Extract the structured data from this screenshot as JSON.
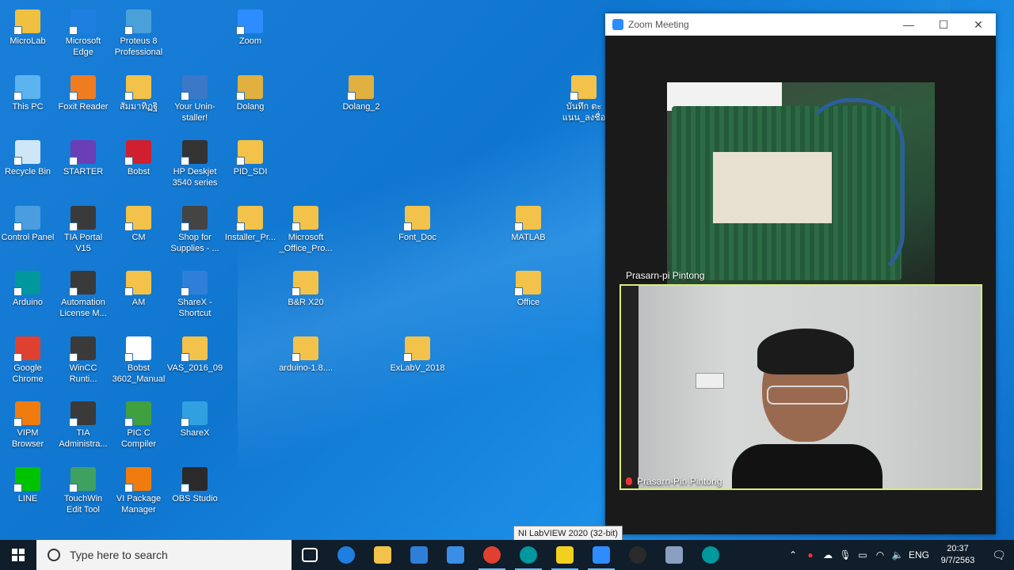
{
  "desktop_icons": [
    {
      "label": "MicroLab",
      "color": "#f0c040"
    },
    {
      "label": "Microsoft Edge",
      "color": "#1f7fe0"
    },
    {
      "label": "Proteus 8 Professional",
      "color": "#4aa0d8"
    },
    {
      "label": "Zoom",
      "color": "#2d8cff"
    },
    {
      "label": "This PC",
      "color": "#5bb4f0"
    },
    {
      "label": "Foxit Reader",
      "color": "#f07c20"
    },
    {
      "label": "สัมมาทิฏฐิ",
      "color": "#f2c24a"
    },
    {
      "label": "Your Unin-staller!",
      "color": "#3a78c8"
    },
    {
      "label": "Dolang",
      "color": "#e0b040"
    },
    {
      "label": "Dolang_2",
      "color": "#e0b040"
    },
    {
      "label": "บันทึก ตะแนน_ลงชื่อ",
      "color": "#f2c24a"
    },
    {
      "label": "Recycle Bin",
      "color": "#cfe6f7"
    },
    {
      "label": "STARTER",
      "color": "#6a3fb5"
    },
    {
      "label": "Bobst",
      "color": "#d02030"
    },
    {
      "label": "HP Deskjet 3540 series",
      "color": "#333333"
    },
    {
      "label": "PID_SDI",
      "color": "#f2c24a"
    },
    {
      "label": "Control Panel",
      "color": "#4a9ee0"
    },
    {
      "label": "TIA Portal V15",
      "color": "#3a3a3a"
    },
    {
      "label": "CM",
      "color": "#f2c24a"
    },
    {
      "label": "Shop for Supplies - ...",
      "color": "#444444"
    },
    {
      "label": "Installer_Pr...",
      "color": "#f2c24a"
    },
    {
      "label": "Microsoft _Office_Pro...",
      "color": "#f2c24a"
    },
    {
      "label": "Font_Doc",
      "color": "#f2c24a"
    },
    {
      "label": "MATLAB",
      "color": "#f2c24a"
    },
    {
      "label": "Arduino",
      "color": "#00979d"
    },
    {
      "label": "Automation License M...",
      "color": "#3a3a3a"
    },
    {
      "label": "AM",
      "color": "#f2c24a"
    },
    {
      "label": "ShareX - Shortcut",
      "color": "#2f7fd8"
    },
    {
      "label": "B&R X20",
      "color": "#f2c24a"
    },
    {
      "label": "Office",
      "color": "#f2c24a"
    },
    {
      "label": "Google Chrome",
      "color": "#e04030"
    },
    {
      "label": "WinCC Runti...",
      "color": "#3a3a3a"
    },
    {
      "label": "Bobst 3602_Manual",
      "color": "#ffffff"
    },
    {
      "label": "VAS_2016_09",
      "color": "#f2c24a"
    },
    {
      "label": "arduino-1.8....",
      "color": "#f2c24a"
    },
    {
      "label": "ExLabV_2018",
      "color": "#f2c24a"
    },
    {
      "label": "VIPM Browser",
      "color": "#f07c10"
    },
    {
      "label": "TIA Administra...",
      "color": "#3a3a3a"
    },
    {
      "label": "PIC C Compiler",
      "color": "#40a040"
    },
    {
      "label": "ShareX",
      "color": "#30a0e0"
    },
    {
      "label": "LINE",
      "color": "#00c300"
    },
    {
      "label": "TouchWin Edit Tool",
      "color": "#40a060"
    },
    {
      "label": "VI Package Manager",
      "color": "#f07c10"
    },
    {
      "label": "OBS Studio",
      "color": "#2a2a2a"
    }
  ],
  "zoom": {
    "title": "Zoom Meeting",
    "minimize": "—",
    "maximize": "☐",
    "close": "✕",
    "top_participant": "Prasarn-pi Pintong",
    "main_participant": "Prasarn-Pin Pintong"
  },
  "tooltip": "NI LabVIEW 2020 (32-bit)",
  "taskbar": {
    "search_placeholder": "Type here to search",
    "apps": [
      {
        "name": "task-view",
        "color": "#ffffff"
      },
      {
        "name": "edge",
        "color": "#1f7fe0"
      },
      {
        "name": "file-explorer",
        "color": "#f2c24a"
      },
      {
        "name": "store",
        "color": "#2f7fd8"
      },
      {
        "name": "mail",
        "color": "#3a8ee6"
      },
      {
        "name": "chrome",
        "color": "#e04030"
      },
      {
        "name": "arduino",
        "color": "#00979d"
      },
      {
        "name": "labview",
        "color": "#f2d020"
      },
      {
        "name": "zoom",
        "color": "#2d8cff"
      },
      {
        "name": "obs",
        "color": "#2a2a2a"
      },
      {
        "name": "user-settings",
        "color": "#8aa0c0"
      },
      {
        "name": "arduino-2",
        "color": "#00979d"
      }
    ],
    "tray": {
      "language": "ENG",
      "time": "20:37",
      "date": "9/7/2563"
    }
  }
}
